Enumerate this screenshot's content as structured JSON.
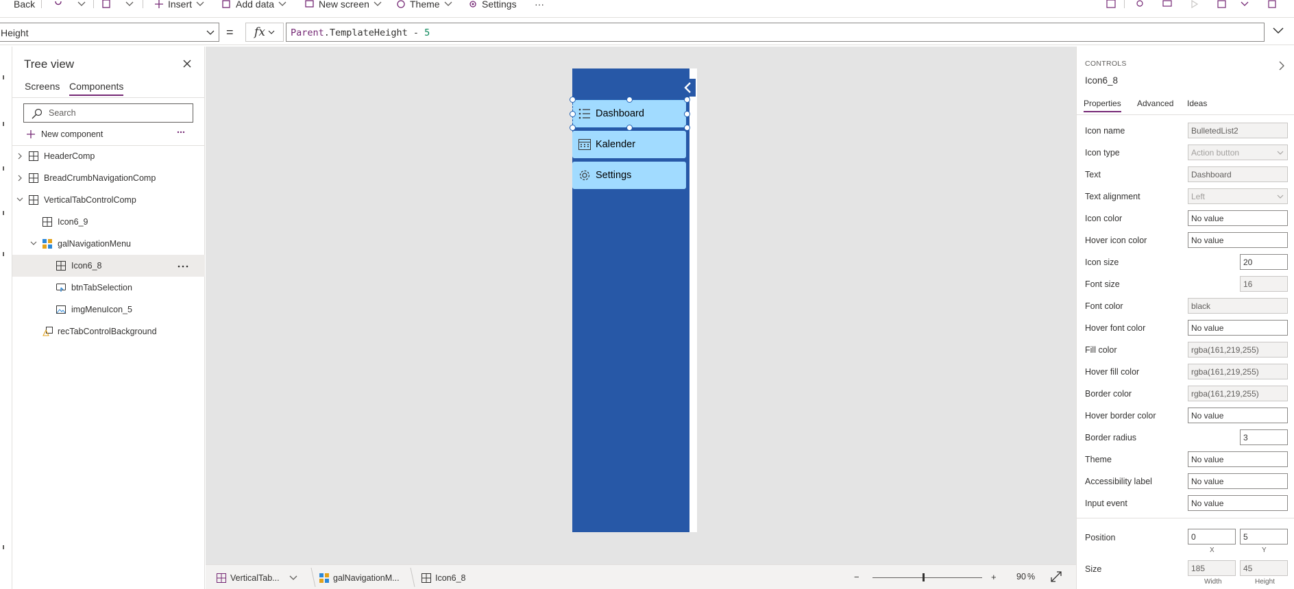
{
  "commandbar": {
    "back": "Back",
    "insert": "Insert",
    "add_data": "Add data",
    "new_screen": "New screen",
    "theme": "Theme",
    "settings": "Settings",
    "more": "···"
  },
  "formula": {
    "property": "Height",
    "equals": "=",
    "fx": "fx",
    "ident": "Parent",
    "member": ".TemplateHeight - ",
    "number": "5"
  },
  "treeview": {
    "title": "Tree view",
    "tabs": [
      "Screens",
      "Components"
    ],
    "active_tab": "Components",
    "search_placeholder": "Search",
    "new_component": "New component",
    "items": [
      {
        "label": "HeaderComp"
      },
      {
        "label": "BreadCrumbNavigationComp"
      },
      {
        "label": "VerticalTabControlComp"
      },
      {
        "label": "Icon6_9"
      },
      {
        "label": "galNavigationMenu"
      },
      {
        "label": "Icon6_8"
      },
      {
        "label": "btnTabSelection"
      },
      {
        "label": "imgMenuIcon_5"
      },
      {
        "label": "recTabControlBackground"
      }
    ]
  },
  "canvas": {
    "menu_items": [
      "Dashboard",
      "Kalender",
      "Settings"
    ],
    "nav_color": "#2758a7",
    "item_color": "#a1dbff"
  },
  "status": {
    "crumbs": [
      "VerticalTab...",
      "galNavigationM...",
      "Icon6_8"
    ],
    "zoom": "90",
    "zoom_unit": "%",
    "zoom_minus": "−",
    "zoom_plus": "+"
  },
  "properties": {
    "section_label": "CONTROLS",
    "control_name": "Icon6_8",
    "tabs": [
      "Properties",
      "Advanced",
      "Ideas"
    ],
    "rows": [
      {
        "label": "Icon name",
        "value": "BulletedList2"
      },
      {
        "label": "Icon type",
        "value": "Action button"
      },
      {
        "label": "Text",
        "value": "Dashboard"
      },
      {
        "label": "Text alignment",
        "value": "Left"
      },
      {
        "label": "Icon color",
        "value": "No value"
      },
      {
        "label": "Hover icon color",
        "value": "No value"
      },
      {
        "label": "Icon size",
        "value": "20"
      },
      {
        "label": "Font size",
        "value": "16"
      },
      {
        "label": "Font color",
        "value": "black"
      },
      {
        "label": "Hover font color",
        "value": "No value"
      },
      {
        "label": "Fill color",
        "value": "rgba(161,219,255)"
      },
      {
        "label": "Hover fill color",
        "value": "rgba(161,219,255)"
      },
      {
        "label": "Border color",
        "value": "rgba(161,219,255)"
      },
      {
        "label": "Hover border color",
        "value": "No value"
      },
      {
        "label": "Border radius",
        "value": "3"
      },
      {
        "label": "Theme",
        "value": "No value"
      },
      {
        "label": "Accessibility label",
        "value": "No value"
      },
      {
        "label": "Input event",
        "value": "No value"
      }
    ],
    "position": {
      "label": "Position",
      "x": "0",
      "y": "5",
      "x_label": "X",
      "y_label": "Y"
    },
    "size": {
      "label": "Size",
      "width": "185",
      "height": "45",
      "width_label": "Width",
      "height_label": "Height"
    }
  }
}
